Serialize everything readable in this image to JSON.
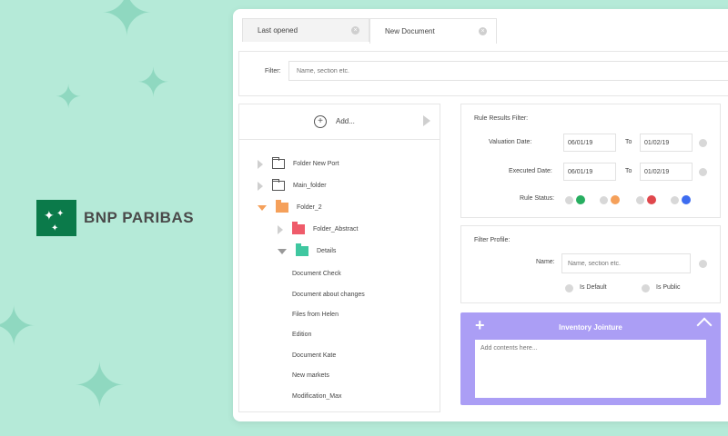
{
  "brand": {
    "name": "BNP PARIBAS",
    "logo_color": "#0b7a4a"
  },
  "tabs": [
    {
      "label": "Last opened",
      "close_icon": "close-icon"
    },
    {
      "label": "New Document",
      "close_icon": "close-icon"
    }
  ],
  "filter": {
    "label": "Filter:",
    "placeholder": "Name, section etc."
  },
  "tree": {
    "add_label": "Add...",
    "items": [
      {
        "label": "Folder New Port"
      },
      {
        "label": "Main_folder"
      },
      {
        "label": "Folder_2"
      },
      {
        "label": "Folder_Abstract"
      },
      {
        "label": "Details"
      },
      {
        "label": "Document Check"
      },
      {
        "label": "Document about changes"
      },
      {
        "label": "Files from Helen"
      },
      {
        "label": "Edition"
      },
      {
        "label": "Document Kate"
      },
      {
        "label": "New markets"
      },
      {
        "label": "Modification_Max"
      }
    ]
  },
  "rule_filter": {
    "title": "Rule Results Filter:",
    "valuation_label": "Valuation Date:",
    "valuation_from": "06/01/19",
    "to_label": "To",
    "valuation_to": "01/02/19",
    "executed_label": "Executed Date:",
    "executed_from": "06/01/19",
    "executed_to": "01/02/19",
    "status_label": "Rule Status:",
    "status_colors": [
      "#27ae60",
      "#f5a05a",
      "#e0474c",
      "#3d6cf0"
    ]
  },
  "filter_profile": {
    "title": "Filter Profile:",
    "name_label": "Name:",
    "name_placeholder": "Name, section etc.",
    "is_default_label": "Is Default",
    "is_public_label": "Is Public"
  },
  "inventory": {
    "title": "Inventory Jointure",
    "placeholder": "Add contents here..."
  },
  "colors": {
    "accent_purple": "#ab9ef5",
    "folder_orange": "#f5a05a",
    "folder_red": "#ef5b6a",
    "folder_teal": "#3fc7a0"
  }
}
